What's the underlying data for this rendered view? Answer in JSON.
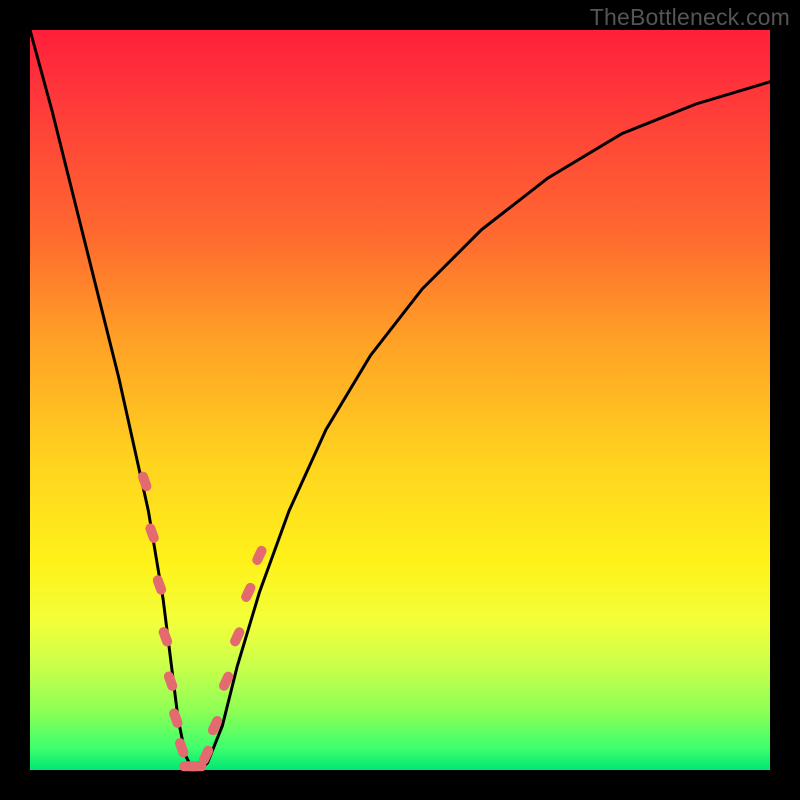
{
  "watermark": {
    "text": "TheBottleneck.com"
  },
  "chart_data": {
    "type": "line",
    "title": "",
    "xlabel": "",
    "ylabel": "",
    "xlim": [
      0,
      100
    ],
    "ylim": [
      0,
      100
    ],
    "series": [
      {
        "name": "bottleneck-curve",
        "x": [
          0,
          3,
          6,
          9,
          12,
          14,
          16,
          18,
          19,
          20,
          21,
          22,
          23,
          24,
          26,
          28,
          31,
          35,
          40,
          46,
          53,
          61,
          70,
          80,
          90,
          100
        ],
        "values": [
          100,
          89,
          77,
          65,
          53,
          44,
          35,
          23,
          15,
          7,
          2,
          0,
          0,
          1,
          6,
          14,
          24,
          35,
          46,
          56,
          65,
          73,
          80,
          86,
          90,
          93
        ]
      }
    ],
    "markers": {
      "name": "highlight-dots",
      "color": "#e36a6f",
      "points": [
        {
          "x": 15.5,
          "y": 39
        },
        {
          "x": 16.5,
          "y": 32
        },
        {
          "x": 17.5,
          "y": 25
        },
        {
          "x": 18.3,
          "y": 18
        },
        {
          "x": 19.0,
          "y": 12
        },
        {
          "x": 19.7,
          "y": 7
        },
        {
          "x": 20.5,
          "y": 3
        },
        {
          "x": 21.5,
          "y": 0.5
        },
        {
          "x": 22.5,
          "y": 0.5
        },
        {
          "x": 23.8,
          "y": 2
        },
        {
          "x": 25.0,
          "y": 6
        },
        {
          "x": 26.5,
          "y": 12
        },
        {
          "x": 28.0,
          "y": 18
        },
        {
          "x": 29.5,
          "y": 24
        },
        {
          "x": 31.0,
          "y": 29
        }
      ]
    }
  }
}
